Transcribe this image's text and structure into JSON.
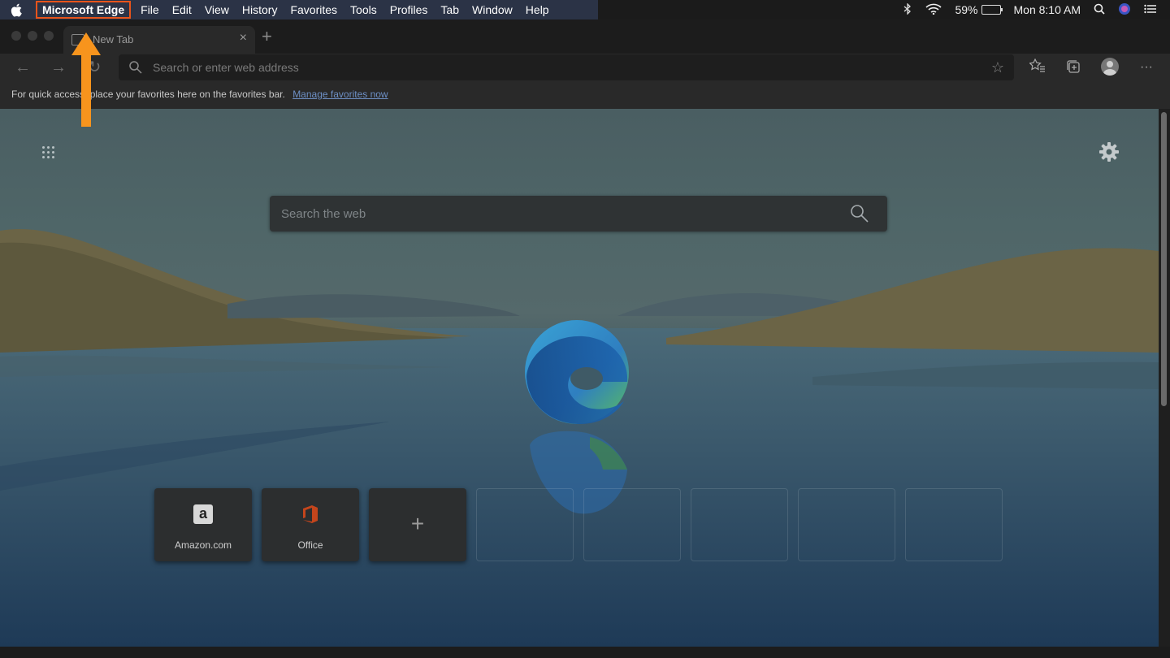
{
  "menubar": {
    "app_name": "Microsoft Edge",
    "items": [
      "File",
      "Edit",
      "View",
      "History",
      "Favorites",
      "Tools",
      "Profiles",
      "Tab",
      "Window",
      "Help"
    ],
    "battery": "59%",
    "clock": "Mon 8:10 AM"
  },
  "browser": {
    "tab_title": "New Tab",
    "address_placeholder": "Search or enter web address",
    "favorites_bar": {
      "message": "For quick access, place your favorites here on the favorites bar.",
      "link": "Manage favorites now"
    }
  },
  "new_tab_page": {
    "search_placeholder": "Search the web",
    "quick_links": [
      {
        "label": "Amazon.com",
        "icon": "amazon-icon"
      },
      {
        "label": "Office",
        "icon": "office-icon"
      }
    ]
  },
  "colors": {
    "annotation_highlight": "#e8541b",
    "annotation_arrow": "#f7941d"
  }
}
